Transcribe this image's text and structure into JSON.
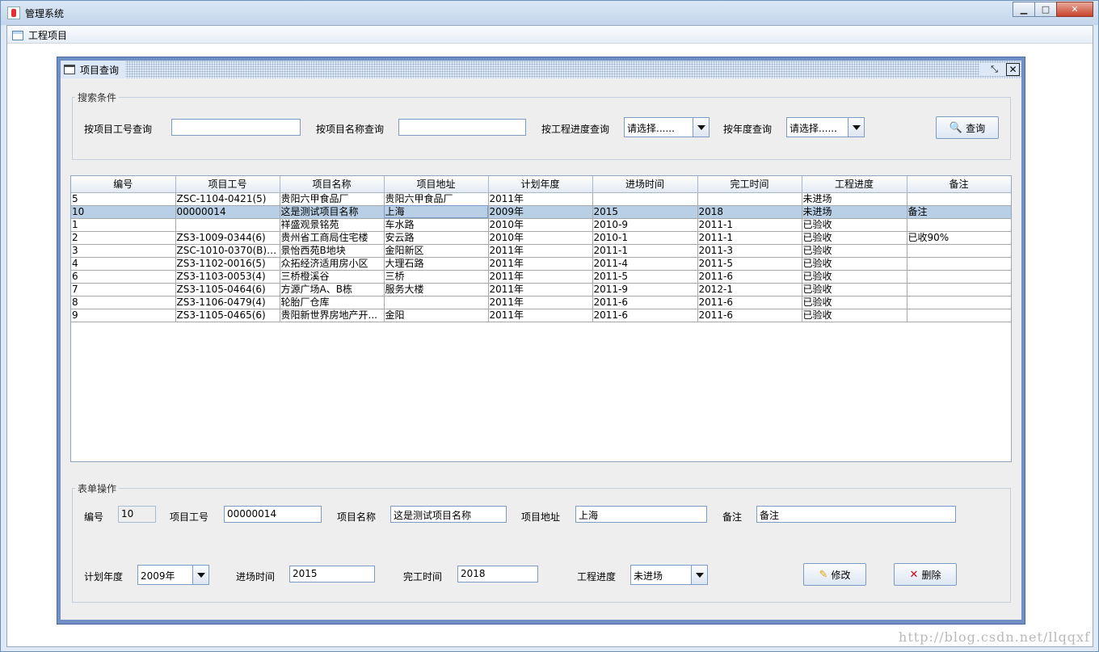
{
  "window": {
    "title": "管理系统"
  },
  "menubar": {
    "items": [
      {
        "label": "工程项目"
      }
    ]
  },
  "frame": {
    "title": "项目查询"
  },
  "search": {
    "legend": "搜索条件",
    "by_code_label": "按项目工号查询",
    "by_name_label": "按项目名称查询",
    "by_progress_label": "按工程进度查询",
    "progress_value": "请选择......",
    "by_year_label": "按年度查询",
    "year_value": "请选择......",
    "search_button": "查询"
  },
  "table": {
    "columns": [
      "编号",
      "项目工号",
      "项目名称",
      "项目地址",
      "计划年度",
      "进场时间",
      "完工时间",
      "工程进度",
      "备注"
    ],
    "rows": [
      [
        "5",
        "ZSC-1104-0421(5)",
        "贵阳六甲食品厂",
        "贵阳六甲食品厂",
        "2011年",
        "",
        "",
        "未进场",
        ""
      ],
      [
        "10",
        "00000014",
        "这是测试项目名称",
        "上海",
        "2009年",
        "2015",
        "2018",
        "未进场",
        "备注"
      ],
      [
        "1",
        "",
        "祥盛观景铭苑",
        "车水路",
        "2010年",
        "2010-9",
        "2011-1",
        "已验收",
        ""
      ],
      [
        "2",
        "ZS3-1009-0344(6)",
        "贵州省工商局住宅楼",
        "安云路",
        "2010年",
        "2010-1",
        "2011-1",
        "已验收",
        "已收90%"
      ],
      [
        "3",
        "ZSC-1010-0370(B)(5...",
        "景怡西苑B地块",
        "金阳新区",
        "2011年",
        "2011-1",
        "2011-3",
        "已验收",
        ""
      ],
      [
        "4",
        "ZS3-1102-0016(5)",
        "众拓经济适用房小区",
        "大理石路",
        "2011年",
        "2011-4",
        "2011-5",
        "已验收",
        ""
      ],
      [
        "6",
        "ZS3-1103-0053(4)",
        "三桥橙溪谷",
        "三桥",
        "2011年",
        "2011-5",
        "2011-6",
        "已验收",
        ""
      ],
      [
        "7",
        "ZS3-1105-0464(6)",
        "方源广场A、B栋",
        "服务大楼",
        "2011年",
        "2011-9",
        "2012-1",
        "已验收",
        ""
      ],
      [
        "8",
        "ZS3-1106-0479(4)",
        "轮胎厂仓库",
        "",
        "2011年",
        "2011-6",
        "2011-6",
        "已验收",
        ""
      ],
      [
        "9",
        "ZS3-1105-0465(6)",
        "贵阳新世界房地产开...",
        "金阳",
        "2011年",
        "2011-6",
        "2011-6",
        "已验收",
        ""
      ]
    ],
    "selected_row": 1
  },
  "form": {
    "legend": "表单操作",
    "id_label": "编号",
    "id_value": "10",
    "code_label": "项目工号",
    "code_value": "00000014",
    "name_label": "项目名称",
    "name_value": "这是测试项目名称",
    "address_label": "项目地址",
    "address_value": "上海",
    "remark_label": "备注",
    "remark_value": "备注",
    "year_label": "计划年度",
    "year_value": "2009年",
    "entry_label": "进场时间",
    "entry_value": "2015",
    "finish_label": "完工时间",
    "finish_value": "2018",
    "progress_label": "工程进度",
    "progress_value": "未进场",
    "edit_button": "修改",
    "delete_button": "删除"
  },
  "watermark": "http://blog.csdn.net/llqqxf",
  "colors": {
    "frame_border": "#6f8fc5",
    "selection": "#b8cfe5",
    "delete_icon": "#d0021b",
    "edit_icon": "#e2a400"
  }
}
